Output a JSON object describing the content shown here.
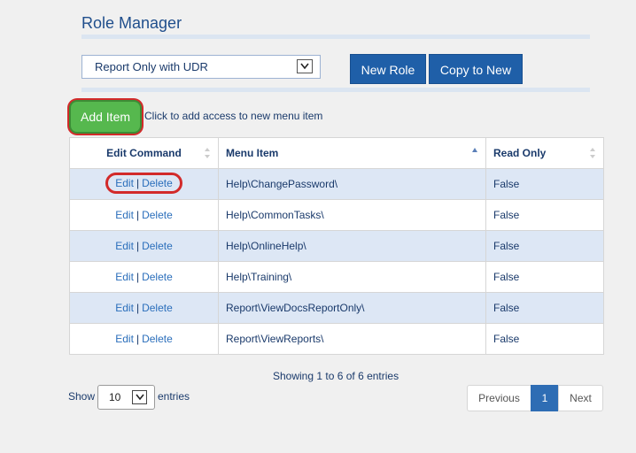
{
  "header": {
    "title": "Role Manager"
  },
  "role_select": {
    "value": "Report Only with UDR"
  },
  "toolbar": {
    "new_role": "New Role",
    "copy_to_new": "Copy to New"
  },
  "add_item": {
    "label": "Add Item",
    "hint": "Click to add access to new menu item"
  },
  "table": {
    "headers": {
      "edit": "Edit Command",
      "menu": "Menu Item",
      "readonly": "Read Only"
    },
    "edit_label": "Edit",
    "sep": "|",
    "delete_label": "Delete",
    "rows": [
      {
        "menu": "Help\\ChangePassword\\",
        "readonly": "False"
      },
      {
        "menu": "Help\\CommonTasks\\",
        "readonly": "False"
      },
      {
        "menu": "Help\\OnlineHelp\\",
        "readonly": "False"
      },
      {
        "menu": "Help\\Training\\",
        "readonly": "False"
      },
      {
        "menu": "Report\\ViewDocsReportOnly\\",
        "readonly": "False"
      },
      {
        "menu": "Report\\ViewReports\\",
        "readonly": "False"
      }
    ]
  },
  "footer": {
    "showing": "Showing 1 to 6 of 6 entries",
    "show_label": "Show",
    "page_length": "10",
    "entries_label": "entries",
    "previous": "Previous",
    "page": "1",
    "next": "Next"
  },
  "colors": {
    "accent": "#1f5fa8",
    "add_green": "#56b84e",
    "highlight_ring": "#d22a2a",
    "row_alt": "#dde7f5"
  }
}
